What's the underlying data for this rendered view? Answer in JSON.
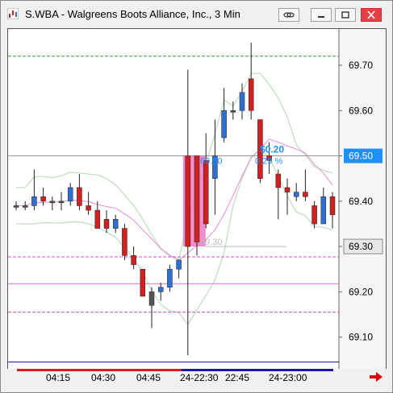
{
  "window": {
    "title": "S.WBA - Walgreens Boots Alliance, Inc., 3 Min"
  },
  "titlebar_buttons": [
    "link-icon",
    "minimize-icon",
    "restore-icon",
    "close-icon"
  ],
  "price_axis": {
    "labels": [
      "69.70",
      "69.60",
      "69.50",
      "69.40",
      "69.30",
      "69.20",
      "69.10"
    ],
    "current_price": "69.50",
    "marker_price": "69.30"
  },
  "time_axis": {
    "labels": [
      "04:15",
      "04:30",
      "04:45",
      "24-22:30",
      "22:45",
      "24-23:00"
    ]
  },
  "annotations": {
    "change_value": "$0.20",
    "change_percent": "0.29 %",
    "measure_high": "69.50",
    "measure_low": "69.30"
  },
  "colors": {
    "up_candle": "#2e6fd1",
    "down_candle": "#d02020",
    "ma_fast": "#e88ad6",
    "band": "#bfe0bf",
    "highlight": "#f178c2",
    "accent": "#1e90ff"
  },
  "chart_data": {
    "type": "candlestick",
    "ylim": [
      69.03,
      69.78
    ],
    "candles": [
      {
        "o": 69.39,
        "h": 69.4,
        "l": 69.38,
        "c": 69.39,
        "dir": "flat"
      },
      {
        "o": 69.39,
        "h": 69.4,
        "l": 69.38,
        "c": 69.39,
        "dir": "flat"
      },
      {
        "o": 69.39,
        "h": 69.47,
        "l": 69.38,
        "c": 69.41,
        "dir": "up"
      },
      {
        "o": 69.41,
        "h": 69.43,
        "l": 69.39,
        "c": 69.4,
        "dir": "down"
      },
      {
        "o": 69.4,
        "h": 69.41,
        "l": 69.38,
        "c": 69.4,
        "dir": "flat"
      },
      {
        "o": 69.4,
        "h": 69.42,
        "l": 69.38,
        "c": 69.4,
        "dir": "flat"
      },
      {
        "o": 69.4,
        "h": 69.44,
        "l": 69.39,
        "c": 69.43,
        "dir": "up"
      },
      {
        "o": 69.43,
        "h": 69.46,
        "l": 69.38,
        "c": 69.39,
        "dir": "down"
      },
      {
        "o": 69.39,
        "h": 69.42,
        "l": 69.37,
        "c": 69.38,
        "dir": "down"
      },
      {
        "o": 69.38,
        "h": 69.4,
        "l": 69.34,
        "c": 69.34,
        "dir": "down"
      },
      {
        "o": 69.36,
        "h": 69.38,
        "l": 69.33,
        "c": 69.34,
        "dir": "down"
      },
      {
        "o": 69.34,
        "h": 69.37,
        "l": 69.33,
        "c": 69.36,
        "dir": "up"
      },
      {
        "o": 69.34,
        "h": 69.35,
        "l": 69.27,
        "c": 69.28,
        "dir": "down"
      },
      {
        "o": 69.28,
        "h": 69.3,
        "l": 69.25,
        "c": 69.26,
        "dir": "down"
      },
      {
        "o": 69.25,
        "h": 69.25,
        "l": 69.19,
        "c": 69.19,
        "dir": "down"
      },
      {
        "o": 69.17,
        "h": 69.21,
        "l": 69.12,
        "c": 69.2,
        "dir": "flat"
      },
      {
        "o": 69.2,
        "h": 69.22,
        "l": 69.18,
        "c": 69.21,
        "dir": "up"
      },
      {
        "o": 69.21,
        "h": 69.26,
        "l": 69.2,
        "c": 69.25,
        "dir": "up"
      },
      {
        "o": 69.25,
        "h": 69.27,
        "l": 69.23,
        "c": 69.27,
        "dir": "up"
      },
      {
        "o": 69.3,
        "h": 69.69,
        "l": 69.06,
        "c": 69.5,
        "dir": "down"
      },
      {
        "o": 69.31,
        "h": 69.5,
        "l": 69.28,
        "c": 69.5,
        "dir": "down"
      },
      {
        "o": 69.35,
        "h": 69.55,
        "l": 69.34,
        "c": 69.49,
        "dir": "down"
      },
      {
        "o": 69.45,
        "h": 69.58,
        "l": 69.37,
        "c": 69.5,
        "dir": "up"
      },
      {
        "o": 69.54,
        "h": 69.65,
        "l": 69.53,
        "c": 69.6,
        "dir": "up"
      },
      {
        "o": 69.6,
        "h": 69.62,
        "l": 69.58,
        "c": 69.6,
        "dir": "flat"
      },
      {
        "o": 69.6,
        "h": 69.66,
        "l": 69.58,
        "c": 69.64,
        "dir": "up"
      },
      {
        "o": 69.67,
        "h": 69.75,
        "l": 69.58,
        "c": 69.6,
        "dir": "down"
      },
      {
        "o": 69.58,
        "h": 69.58,
        "l": 69.44,
        "c": 69.45,
        "dir": "down"
      },
      {
        "o": 69.5,
        "h": 69.53,
        "l": 69.46,
        "c": 69.49,
        "dir": "down"
      },
      {
        "o": 69.46,
        "h": 69.47,
        "l": 69.36,
        "c": 69.43,
        "dir": "down"
      },
      {
        "o": 69.43,
        "h": 69.45,
        "l": 69.37,
        "c": 69.42,
        "dir": "down"
      },
      {
        "o": 69.41,
        "h": 69.44,
        "l": 69.4,
        "c": 69.42,
        "dir": "up"
      },
      {
        "o": 69.42,
        "h": 69.47,
        "l": 69.4,
        "c": 69.41,
        "dir": "down"
      },
      {
        "o": 69.39,
        "h": 69.4,
        "l": 69.34,
        "c": 69.35,
        "dir": "down"
      },
      {
        "o": 69.35,
        "h": 69.43,
        "l": 69.35,
        "c": 69.41,
        "dir": "up"
      },
      {
        "o": 69.41,
        "h": 69.42,
        "l": 69.34,
        "c": 69.37,
        "dir": "down"
      }
    ],
    "hlines": [
      {
        "price": 69.72,
        "color": "#2ca02c",
        "dashed": true
      },
      {
        "price": 69.5,
        "color": "#9a9a9a",
        "dashed": false
      },
      {
        "price": 69.277,
        "color": "#d24fc6",
        "dashed": true
      },
      {
        "price": 69.218,
        "color": "#e56bd6",
        "dashed": false
      },
      {
        "price": 69.155,
        "color": "#d24fc6",
        "dashed": true
      },
      {
        "price": 69.045,
        "color": "#1a1aa0",
        "dashed": false
      }
    ]
  }
}
